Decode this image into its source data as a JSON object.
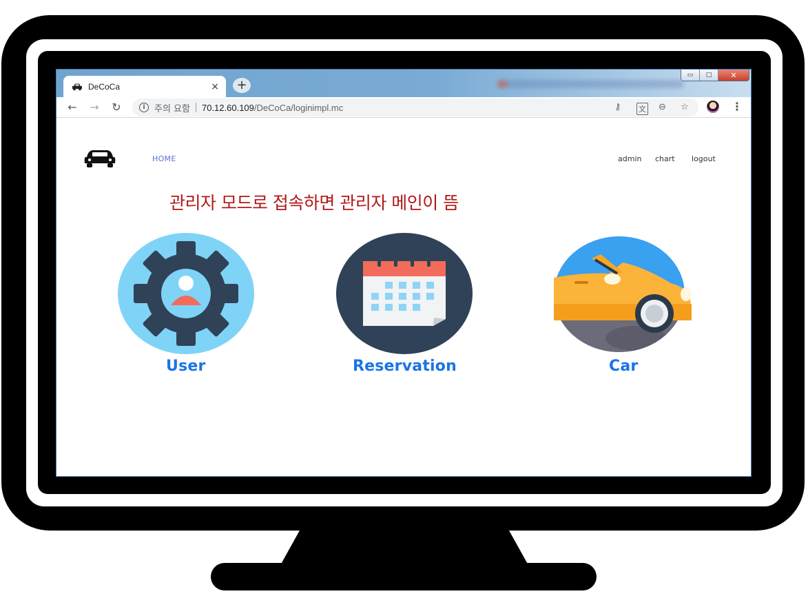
{
  "browser": {
    "tab": {
      "title": "DeCoCa",
      "close_symbol": "×"
    },
    "new_tab_symbol": "+",
    "window_controls": {
      "minimize": "▭",
      "maximize": "□",
      "close": "✕"
    },
    "address_bar": {
      "security_label": "주의 요함",
      "url_host": "70.12.60.109",
      "url_path": "/DeCoCa/loginimpl.mc"
    },
    "toolbar_icons": [
      "key-icon",
      "translate-icon",
      "zoom-icon",
      "star-icon",
      "profile-avatar",
      "menu-icon"
    ]
  },
  "header": {
    "nav_home": "HOME",
    "nav_right": [
      "admin",
      "chart",
      "logout"
    ]
  },
  "notice": "관리자 모드로 접속하면 관리자 메인이 뜸",
  "cards": [
    {
      "label": "User",
      "icon": "gear-user-icon"
    },
    {
      "label": "Reservation",
      "icon": "calendar-icon"
    },
    {
      "label": "Car",
      "icon": "yellow-car-icon"
    }
  ],
  "colors": {
    "accent_label": "#1a73e8",
    "notice": "#b21717",
    "nav_home": "#5a6fd6"
  }
}
